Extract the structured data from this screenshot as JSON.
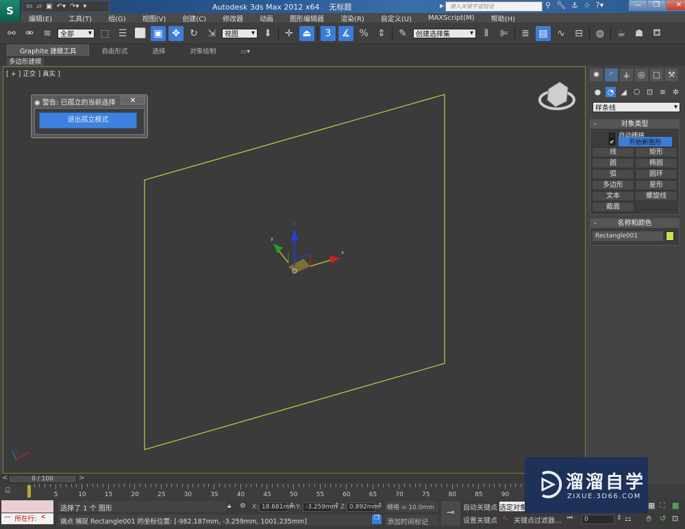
{
  "app": {
    "logo_glyph": "S",
    "title": "Autodesk 3ds Max  2012 x64",
    "doc_name": "无标题",
    "help_search_placeholder": "键入关键字或短语",
    "window_buttons": [
      "—",
      "❐",
      "✕"
    ]
  },
  "quick_access": [
    "new-icon",
    "open-icon",
    "save-icon",
    "undo-icon",
    "redo-icon",
    "customize-icon"
  ],
  "menu": [
    "编辑(E)",
    "工具(T)",
    "组(G)",
    "视图(V)",
    "创建(C)",
    "修改器",
    "动画",
    "图形编辑器",
    "渲染(R)",
    "自定义(U)",
    "MAXScript(M)",
    "帮助(H)"
  ],
  "toolbar": {
    "selection_filter": "全部",
    "ref_coord": "视图",
    "named_selection": "创建选择集"
  },
  "ribbon": {
    "tabs": [
      "Graphite 建模工具",
      "自由形式",
      "选择",
      "对象绘制"
    ],
    "active_tab": 0,
    "sub_label": "多边形建模"
  },
  "viewport": {
    "label": "[ + ] 正交 ] 真实 ]",
    "shape_color": "#c8c24a",
    "gizmo_labels": {
      "x": "x",
      "y": "y",
      "z": "z"
    },
    "axis_colors": {
      "x": "#d42020",
      "y": "#20a020",
      "z": "#2040e0"
    }
  },
  "isolate_dialog": {
    "title": "警告: 已孤立的当前选择",
    "close": "✕",
    "exit_button": "退出孤立模式"
  },
  "command_panel": {
    "category_dropdown": "样条线",
    "object_type": {
      "header": "对象类型",
      "auto_grid": "自动栅格",
      "auto_grid_checked": false,
      "start_new_shape": "开始新图形",
      "start_new_shape_checked": true,
      "buttons": [
        "线",
        "矩形",
        "圆",
        "椭圆",
        "弧",
        "圆环",
        "多边形",
        "星形",
        "文本",
        "螺旋线",
        "截面"
      ]
    },
    "name_color": {
      "header": "名称和颜色",
      "object_name": "Rectangle001",
      "color": "#c9e24a"
    }
  },
  "timeline": {
    "slider_label": "0 / 100",
    "prev": "<",
    "next": ">",
    "current_frame": 0,
    "total_frames": 100,
    "ticks": [
      0,
      5,
      10,
      15,
      20,
      25,
      30,
      35,
      40,
      45,
      50,
      55,
      60,
      65,
      70,
      75,
      80,
      85,
      90
    ]
  },
  "status": {
    "maxscript_line": "所在行:",
    "maxscript_prefix": "—",
    "selection_text": "选择了 1 个 图形",
    "prompt_text": "端点 捕捉 Rectangle001 的坐标位置: [-982.187mm, -3.259mm, 1001.235mm]",
    "x_label": "X:",
    "x_value": "18.681mm",
    "y_label": "Y:",
    "y_value": "-3.259mm",
    "z_label": "Z:",
    "z_value": "0.892mm",
    "grid": "栅格 = 10.0mm",
    "add_time_tag": "添加时间标记",
    "auto_key": "自动关键点",
    "set_key": "设置关键点",
    "selected_dropdown": "选定对象",
    "key_filters": "关键点过滤器...",
    "frame_value": "0"
  },
  "watermark": {
    "title": "溜溜自学",
    "url": "ZIXUE.3D66.COM"
  }
}
